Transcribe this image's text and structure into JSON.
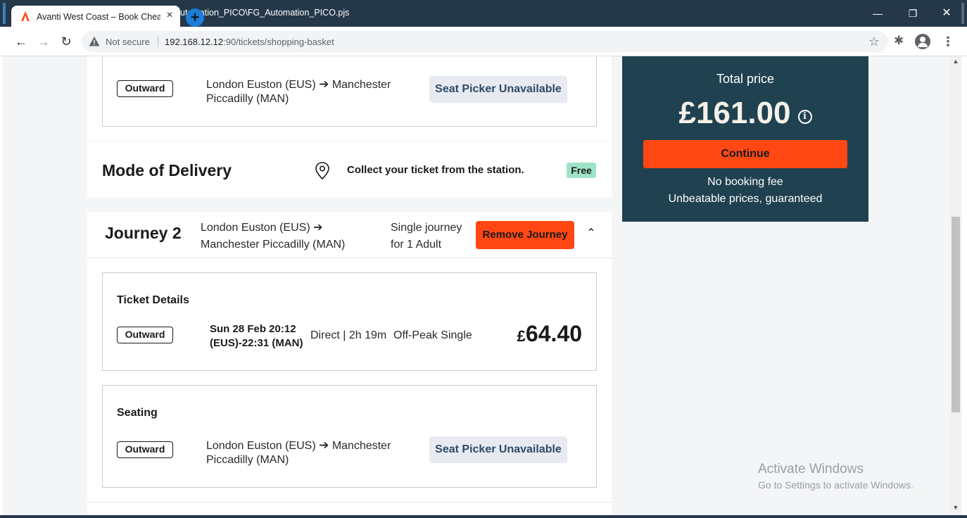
{
  "browser": {
    "active_tab_title": "Avanti West Coast – Book Cheap",
    "background_tab_title": "utomation_PICO\\FG_Automation_PICO.pjs",
    "new_tab_label": "+",
    "security_label": "Not secure",
    "url_host": "192.168.12.12",
    "url_path": ":90/tickets/shopping-basket",
    "icons": [
      "back-arrow-icon",
      "forward-arrow-icon",
      "reload-icon",
      "warning-icon",
      "star-icon",
      "puzzle-icon",
      "profile-icon",
      "kebab-menu-icon"
    ]
  },
  "window_controls": {
    "minimize": "—",
    "maximize": "❐",
    "close": "✕"
  },
  "journey1_seating": {
    "badge": "Outward",
    "route_from": "London Euston (EUS)",
    "route_arrow": "➔",
    "route_to": "Manchester Piccadilly (MAN)",
    "seat_button": "Seat Picker Unavailable"
  },
  "delivery": {
    "title": "Mode of Delivery",
    "text": "Collect your ticket from the station.",
    "badge": "Free"
  },
  "journey2": {
    "title": "Journey 2",
    "route_from": "London Euston (EUS)",
    "route_arrow": "➔",
    "route_to": "Manchester Piccadilly (MAN)",
    "type_line1": "Single journey",
    "type_line2": "for 1 Adult",
    "remove_button": "Remove Journey",
    "ticket": {
      "heading": "Ticket Details",
      "badge": "Outward",
      "date_line1": "Sun 28 Feb 20:12",
      "date_line2": "(EUS)-22:31 (MAN)",
      "direct": "Direct | 2h 19m",
      "fare_type": "Off-Peak Single",
      "price_currency": "£",
      "price_amount": "64.40"
    },
    "seating": {
      "heading": "Seating",
      "badge": "Outward",
      "route_from": "London Euston (EUS)",
      "route_arrow": "➔",
      "route_to": "Manchester Piccadilly (MAN)",
      "seat_button": "Seat Picker Unavailable"
    }
  },
  "summary": {
    "total_label": "Total price",
    "total_amount": "£161.00",
    "info_glyph": "i",
    "continue_button": "Continue",
    "no_fee": "No booking fee",
    "unbeatable": "Unbeatable prices, guaranteed"
  },
  "watermark": {
    "title": "Activate Windows",
    "subtitle": "Go to Settings to activate Windows."
  },
  "colors": {
    "accent_orange": "#ff4713",
    "summary_bg": "#1f4150",
    "free_badge": "#9fe3c7",
    "seat_button_bg": "#e7ebf1"
  }
}
